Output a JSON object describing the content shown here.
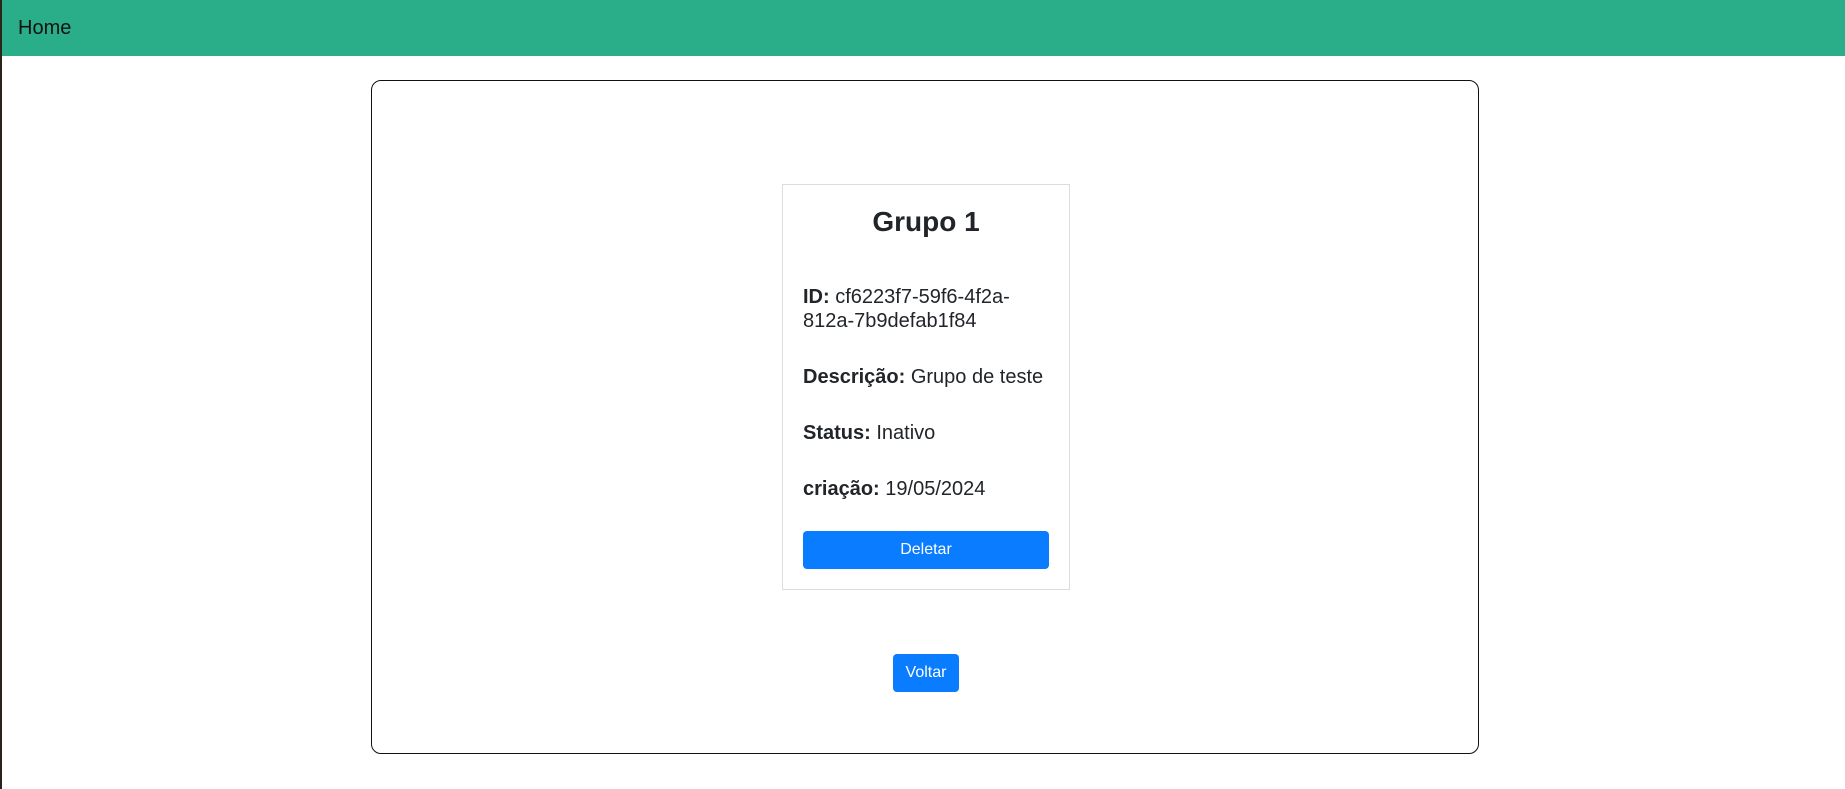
{
  "navbar": {
    "home_label": "Home",
    "color": "#2aae8a"
  },
  "group": {
    "title": "Grupo 1",
    "id_label": "ID:",
    "id_value": "cf6223f7-59f6-4f2a-812a-7b9defab1f84",
    "description_label": "Descrição:",
    "description_value": "Grupo de teste",
    "status_label": "Status:",
    "status_value": "Inativo",
    "created_label": "criação:",
    "created_value": "19/05/2024"
  },
  "actions": {
    "delete_label": "Deletar",
    "back_label": "Voltar",
    "button_color": "#0a7cff"
  }
}
